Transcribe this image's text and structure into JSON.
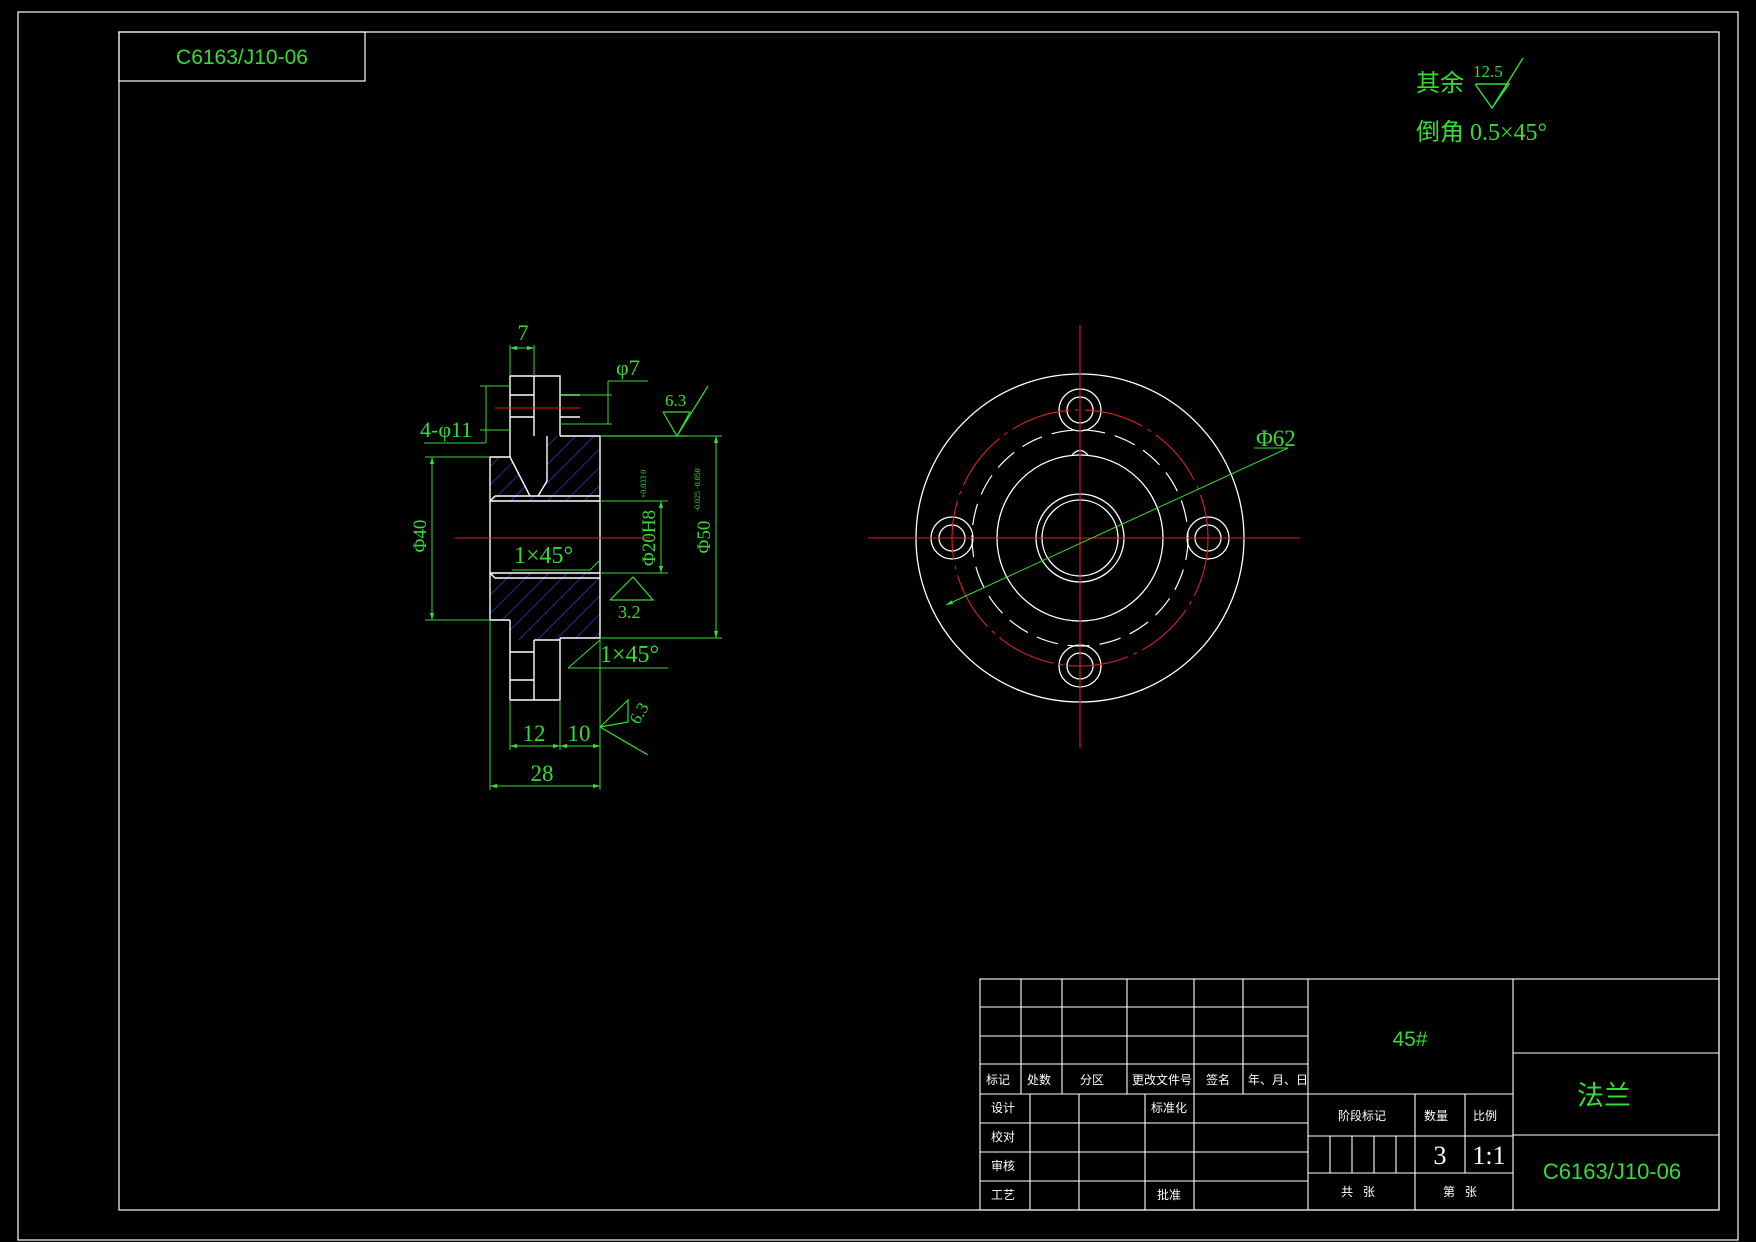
{
  "colors": {
    "background": "#000000",
    "frame": "#ffffff",
    "dimension": "#33dd33",
    "centerline": "#dd2222",
    "hatch": "#3344cc"
  },
  "drawing_code": "C6163/J10-06",
  "notes": {
    "rest_label": "其余",
    "rest_roughness": "12.5",
    "chamfer": "倒角 0.5×45°"
  },
  "section_view": {
    "dims": {
      "d_top": "7",
      "d_hole": "φ7",
      "d_bolt": "4-φ11",
      "d_outer_rough": "6.3",
      "d_phi40": "Φ40",
      "d_bore": "Φ20H8",
      "d_bore_tol": "+0.033 0",
      "d_phi50": "Φ50",
      "d_phi50_tol": "-0.025 -0.050",
      "d_chamfer_inner": "1×45°",
      "d_bore_rough": "3.2",
      "d_chamfer_outer": "1×45°",
      "d_face_rough": "6.3",
      "d_12": "12",
      "d_10": "10",
      "d_28": "28"
    }
  },
  "front_view": {
    "d_phi62": "Φ62"
  },
  "title_block": {
    "material": "45#",
    "part_name": "法兰",
    "code": "C6163/J10-06",
    "headers": [
      "标记",
      "处数",
      "分区",
      "更改文件号",
      "签名",
      "年、月、日"
    ],
    "rows": [
      "设计",
      "校对",
      "审核",
      "工艺"
    ],
    "standardize": "标准化",
    "approve": "批准",
    "stage_mark": "阶段标记",
    "quantity_label": "数量",
    "scale_label": "比例",
    "quantity": "3",
    "scale": "1:1",
    "total_sheets": "共   张",
    "sheet_no": "第   张"
  }
}
